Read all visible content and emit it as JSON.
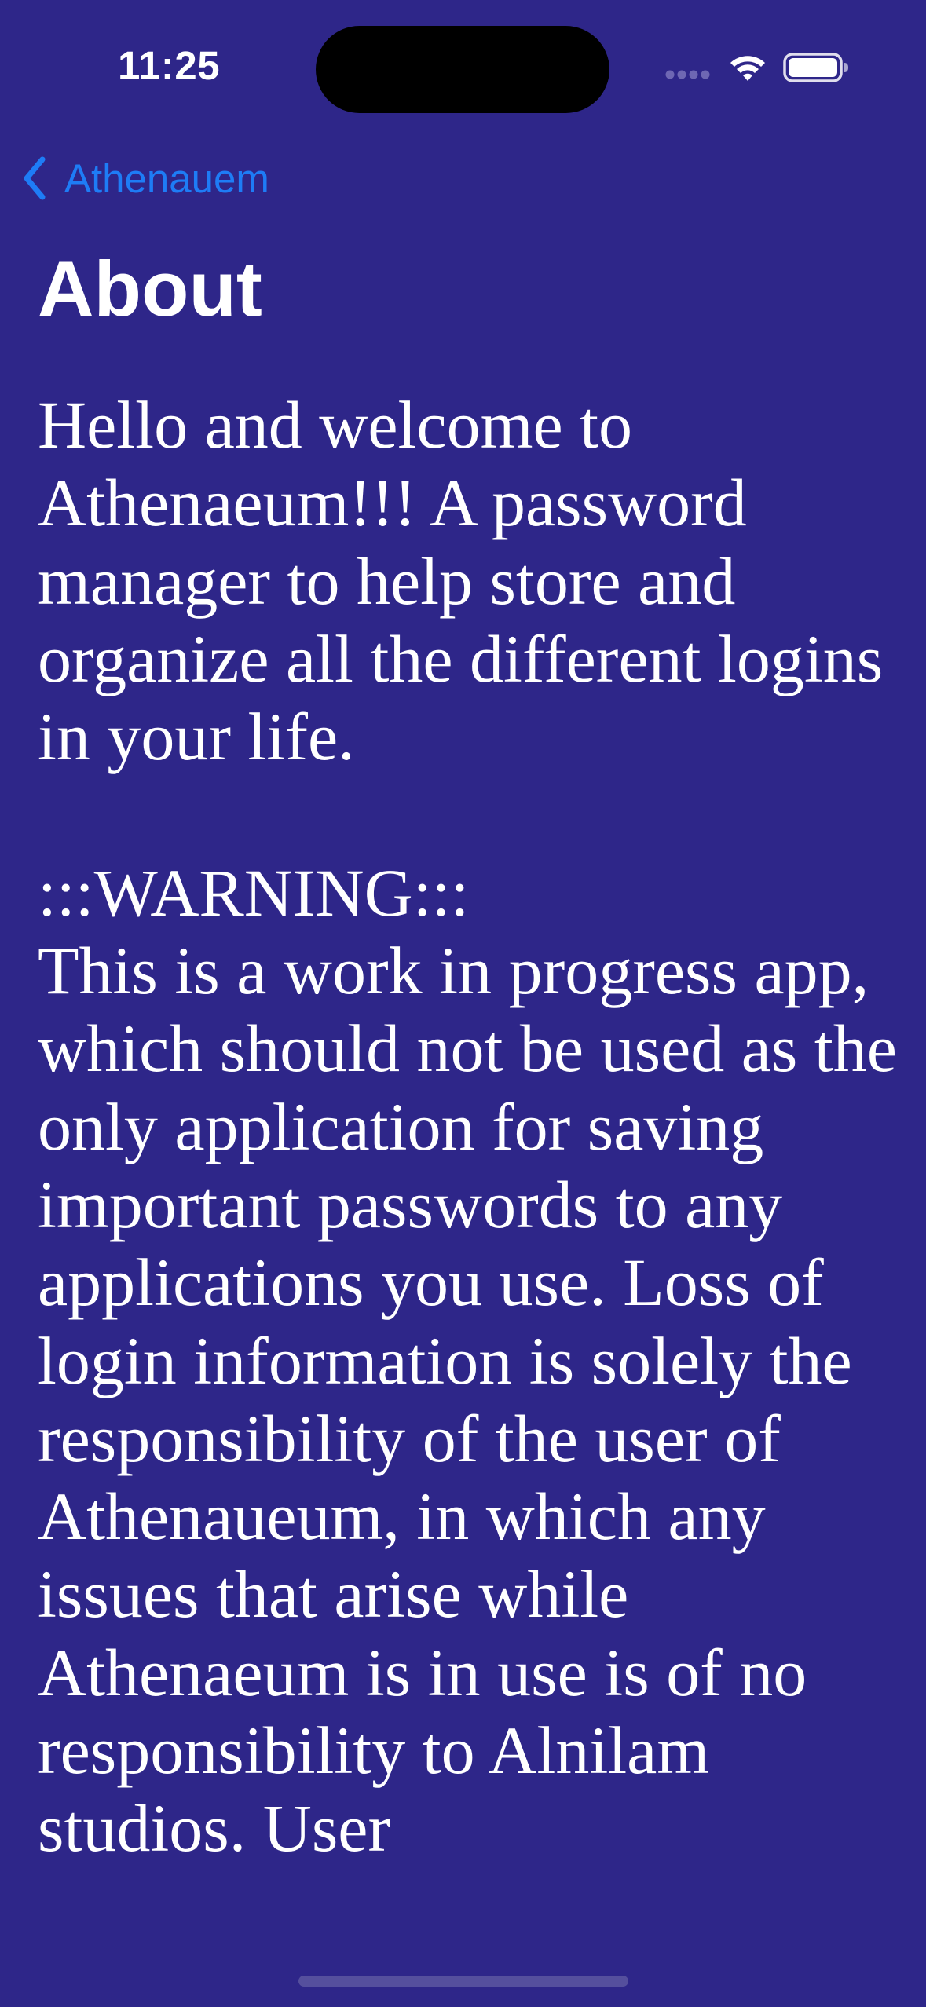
{
  "status_bar": {
    "time": "11:25",
    "icons": [
      "signal-icon",
      "wifi-icon",
      "battery-icon"
    ]
  },
  "nav": {
    "back_label": "Athenauem",
    "back_icon": "chevron-left-icon"
  },
  "page": {
    "title": "About",
    "intro": "Hello and welcome to Athenaeum!!! A password manager to help store and organize all the different logins in your life.",
    "warning_heading": ":::WARNING:::",
    "warning_body": "This is a work in progress app, which should not be used as the only application for saving important passwords to any applications you use. Loss of login information is solely the responsibility of the user of Athenaueum, in which any issues that arise while Athenaeum is in use is of no responsibility to Alnilam studios. User"
  },
  "colors": {
    "background": "#2e2689",
    "text": "#ffffff",
    "link": "#1e7cf6"
  }
}
